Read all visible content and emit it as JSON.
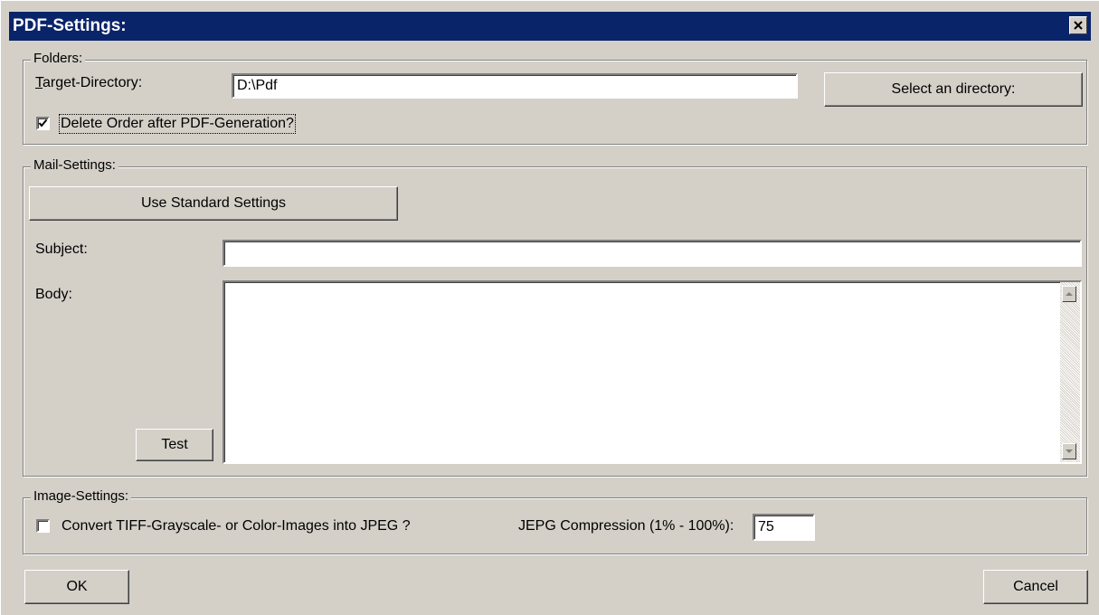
{
  "window": {
    "title": "PDF-Settings:"
  },
  "folders": {
    "legend": "Folders:",
    "target_label_first": "T",
    "target_label_rest": "arget-Directory:",
    "target_value": "D:\\Pdf",
    "select_button": "Select an directory:",
    "delete_order_checked": true,
    "delete_order_label": "Delete Order after PDF-Generation?"
  },
  "mail": {
    "legend": "Mail-Settings:",
    "standard_button": "Use Standard Settings",
    "subject_label": "Subject:",
    "subject_value": "",
    "body_label": "Body:",
    "body_value": "",
    "test_button": "Test"
  },
  "image": {
    "legend": "Image-Settings:",
    "convert_checked": false,
    "convert_label": "Convert TIFF-Grayscale- or Color-Images into JPEG ?",
    "compression_label": "JEPG Compression (1% - 100%):",
    "compression_value": "75"
  },
  "footer": {
    "ok": "OK",
    "cancel": "Cancel"
  }
}
